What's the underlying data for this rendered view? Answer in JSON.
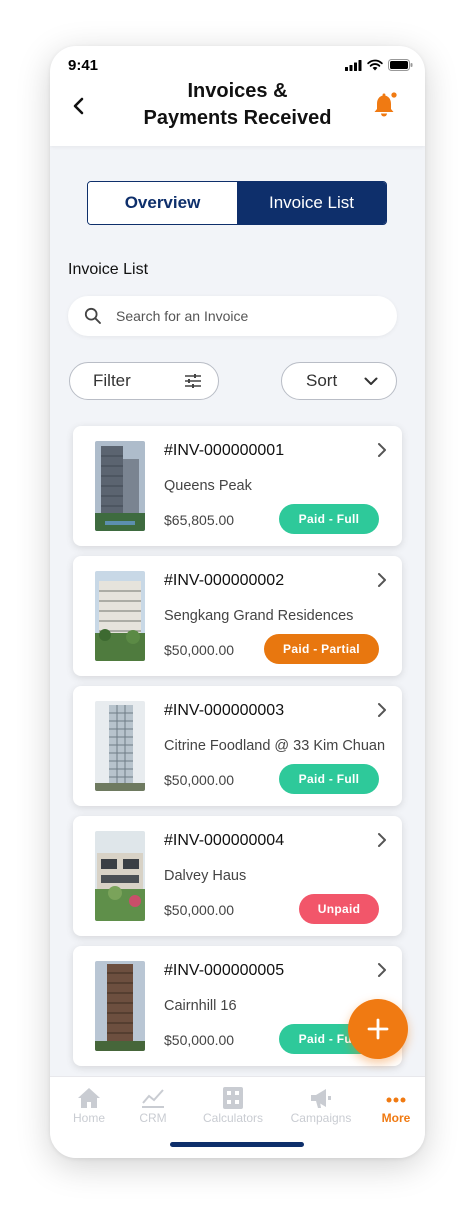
{
  "status_bar": {
    "time": "9:41"
  },
  "header": {
    "title_line1": "Invoices &",
    "title_line2": "Payments Received"
  },
  "tabs": {
    "overview": "Overview",
    "invoice_list": "Invoice List",
    "active": "invoice_list"
  },
  "section_title": "Invoice List",
  "search": {
    "placeholder": "Search for an Invoice",
    "value": ""
  },
  "filter_label": "Filter",
  "sort_label": "Sort",
  "invoices": [
    {
      "number": "#INV-000000001",
      "project": "Queens Peak",
      "amount": "$65,805.00",
      "status": "Paid - Full"
    },
    {
      "number": "#INV-000000002",
      "project": "Sengkang Grand Residences",
      "amount": "$50,000.00",
      "status": "Paid - Partial"
    },
    {
      "number": "#INV-000000003",
      "project": "Citrine Foodland @ 33 Kim Chuan",
      "amount": "$50,000.00",
      "status": "Paid - Full"
    },
    {
      "number": "#INV-000000004",
      "project": "Dalvey Haus",
      "amount": "$50,000.00",
      "status": "Unpaid"
    },
    {
      "number": "#INV-000000005",
      "project": "Cairnhill 16",
      "amount": "$50,000.00",
      "status": "Paid - Full"
    }
  ],
  "bottom_nav": [
    {
      "label": "Home",
      "icon": "home-icon"
    },
    {
      "label": "CRM",
      "icon": "chart-icon"
    },
    {
      "label": "Calculators",
      "icon": "calculator-icon"
    },
    {
      "label": "Campaigns",
      "icon": "megaphone-icon"
    },
    {
      "label": "More",
      "icon": "more-icon",
      "active": true
    }
  ],
  "colors": {
    "primary": "#0e2f6b",
    "accent": "#f07a12",
    "paid_full": "#2ec99a",
    "paid_partial": "#e8770f",
    "unpaid": "#f2566a"
  }
}
